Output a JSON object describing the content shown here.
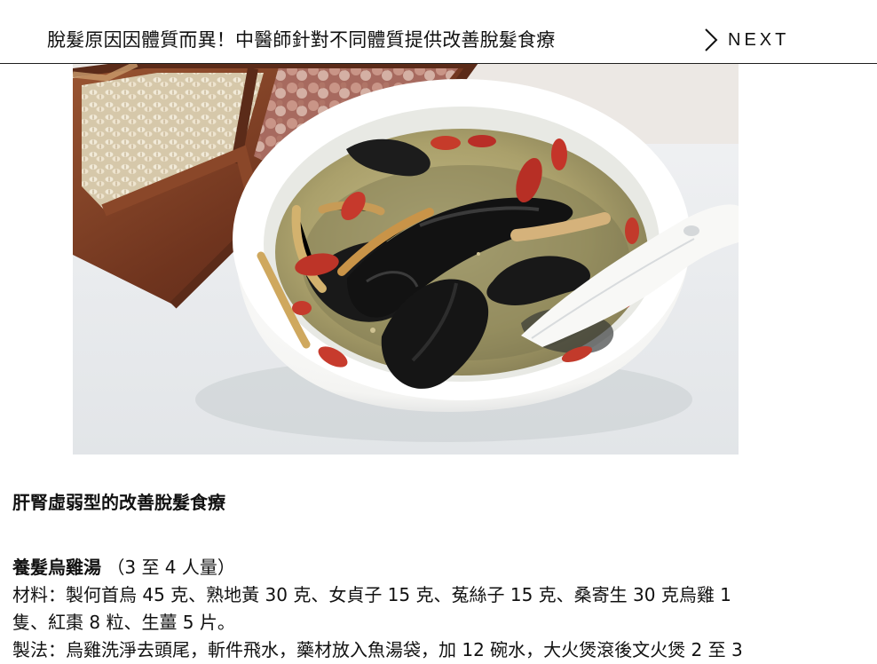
{
  "header": {
    "title": "脫髮原因因體質而異！中醫師針對不同體質提供改善脫髮食療",
    "next_label": "NEXT",
    "next_icon": "chevron-right-icon"
  },
  "hero_image": {
    "subject": "黑色烏雞湯"
  },
  "article": {
    "section_heading": "肝腎虛弱型的改善脫髮食療",
    "recipe": {
      "title": "養髮烏雞湯",
      "serving": "（3 至 4 人量）",
      "ingredients_line_1": "材料：製何首烏 45 克、熟地黃 30 克、女貞子 15 克、菟絲子 15 克、桑寄生 30 克烏雞 1",
      "ingredients_line_2": "隻、紅棗 8 粒、生薑 5 片。",
      "method_line_1": "製法：烏雞洗淨去頭尾，斬件飛水，藥材放入魚湯袋，加 12 碗水，大火煲滾後文火煲 2 至 3"
    }
  },
  "colors": {
    "background": "#ffffff",
    "text": "#111111",
    "header_border": "#1f1f1f",
    "tray_wood": "#7b3f24",
    "soup": "#b8b07a",
    "chicken": "#171717",
    "goji": "#c63b2a"
  }
}
